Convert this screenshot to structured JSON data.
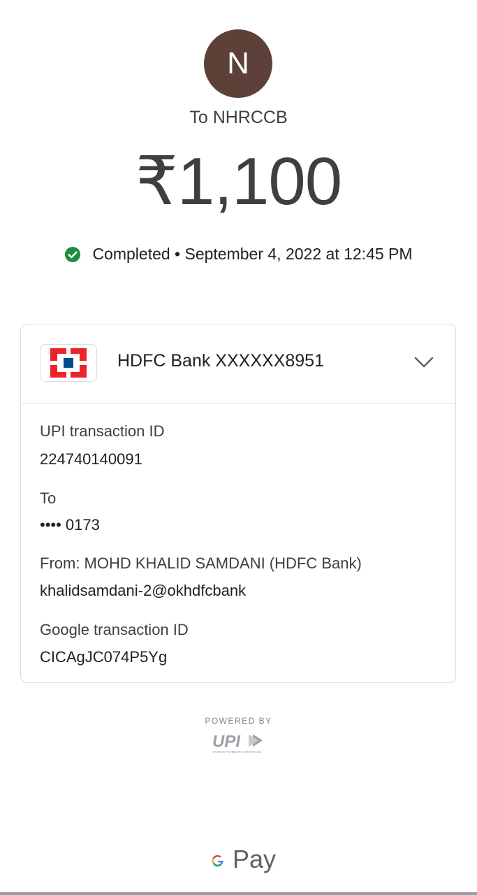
{
  "payee": {
    "initial": "N",
    "to_label": "To NHRCCB"
  },
  "amount": "₹1,100",
  "status": {
    "text": "Completed • September 4, 2022 at 12:45 PM",
    "color": "#1e8e3e"
  },
  "bank": {
    "name": "HDFC Bank XXXXXX8951",
    "logo_colors": [
      "#ed232a",
      "#004c8f"
    ]
  },
  "details": {
    "upi_id_label": "UPI transaction ID",
    "upi_id_value": "224740140091",
    "to_label": "To",
    "to_value": "•••• 0173",
    "from_label": "From: MOHD KHALID SAMDANI (HDFC Bank)",
    "from_value": "khalidsamdani-2@okhdfcbank",
    "google_id_label": "Google transaction ID",
    "google_id_value": "CICAgJC074P5Yg"
  },
  "footer": {
    "powered_by": "POWERED BY",
    "upi_logo_text": "UPI",
    "upi_subtext": "UNIFIED PAYMENTS INTERFACE",
    "gpay_text": "Pay"
  }
}
